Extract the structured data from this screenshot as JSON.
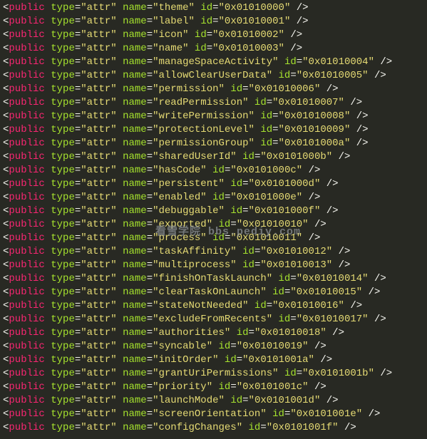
{
  "watermark": "看雪学院 bbs.pediy.com",
  "rows": [
    {
      "type": "attr",
      "name": "theme",
      "id": "0x01010000"
    },
    {
      "type": "attr",
      "name": "label",
      "id": "0x01010001"
    },
    {
      "type": "attr",
      "name": "icon",
      "id": "0x01010002"
    },
    {
      "type": "attr",
      "name": "name",
      "id": "0x01010003"
    },
    {
      "type": "attr",
      "name": "manageSpaceActivity",
      "id": "0x01010004"
    },
    {
      "type": "attr",
      "name": "allowClearUserData",
      "id": "0x01010005"
    },
    {
      "type": "attr",
      "name": "permission",
      "id": "0x01010006"
    },
    {
      "type": "attr",
      "name": "readPermission",
      "id": "0x01010007"
    },
    {
      "type": "attr",
      "name": "writePermission",
      "id": "0x01010008"
    },
    {
      "type": "attr",
      "name": "protectionLevel",
      "id": "0x01010009"
    },
    {
      "type": "attr",
      "name": "permissionGroup",
      "id": "0x0101000a"
    },
    {
      "type": "attr",
      "name": "sharedUserId",
      "id": "0x0101000b"
    },
    {
      "type": "attr",
      "name": "hasCode",
      "id": "0x0101000c"
    },
    {
      "type": "attr",
      "name": "persistent",
      "id": "0x0101000d"
    },
    {
      "type": "attr",
      "name": "enabled",
      "id": "0x0101000e"
    },
    {
      "type": "attr",
      "name": "debuggable",
      "id": "0x0101000f"
    },
    {
      "type": "attr",
      "name": "exported",
      "id": "0x01010010"
    },
    {
      "type": "attr",
      "name": "process",
      "id": "0x01010011"
    },
    {
      "type": "attr",
      "name": "taskAffinity",
      "id": "0x01010012"
    },
    {
      "type": "attr",
      "name": "multiprocess",
      "id": "0x01010013"
    },
    {
      "type": "attr",
      "name": "finishOnTaskLaunch",
      "id": "0x01010014"
    },
    {
      "type": "attr",
      "name": "clearTaskOnLaunch",
      "id": "0x01010015"
    },
    {
      "type": "attr",
      "name": "stateNotNeeded",
      "id": "0x01010016"
    },
    {
      "type": "attr",
      "name": "excludeFromRecents",
      "id": "0x01010017"
    },
    {
      "type": "attr",
      "name": "authorities",
      "id": "0x01010018"
    },
    {
      "type": "attr",
      "name": "syncable",
      "id": "0x01010019"
    },
    {
      "type": "attr",
      "name": "initOrder",
      "id": "0x0101001a"
    },
    {
      "type": "attr",
      "name": "grantUriPermissions",
      "id": "0x0101001b"
    },
    {
      "type": "attr",
      "name": "priority",
      "id": "0x0101001c"
    },
    {
      "type": "attr",
      "name": "launchMode",
      "id": "0x0101001d"
    },
    {
      "type": "attr",
      "name": "screenOrientation",
      "id": "0x0101001e"
    },
    {
      "type": "attr",
      "name": "configChanges",
      "id": "0x0101001f"
    }
  ]
}
